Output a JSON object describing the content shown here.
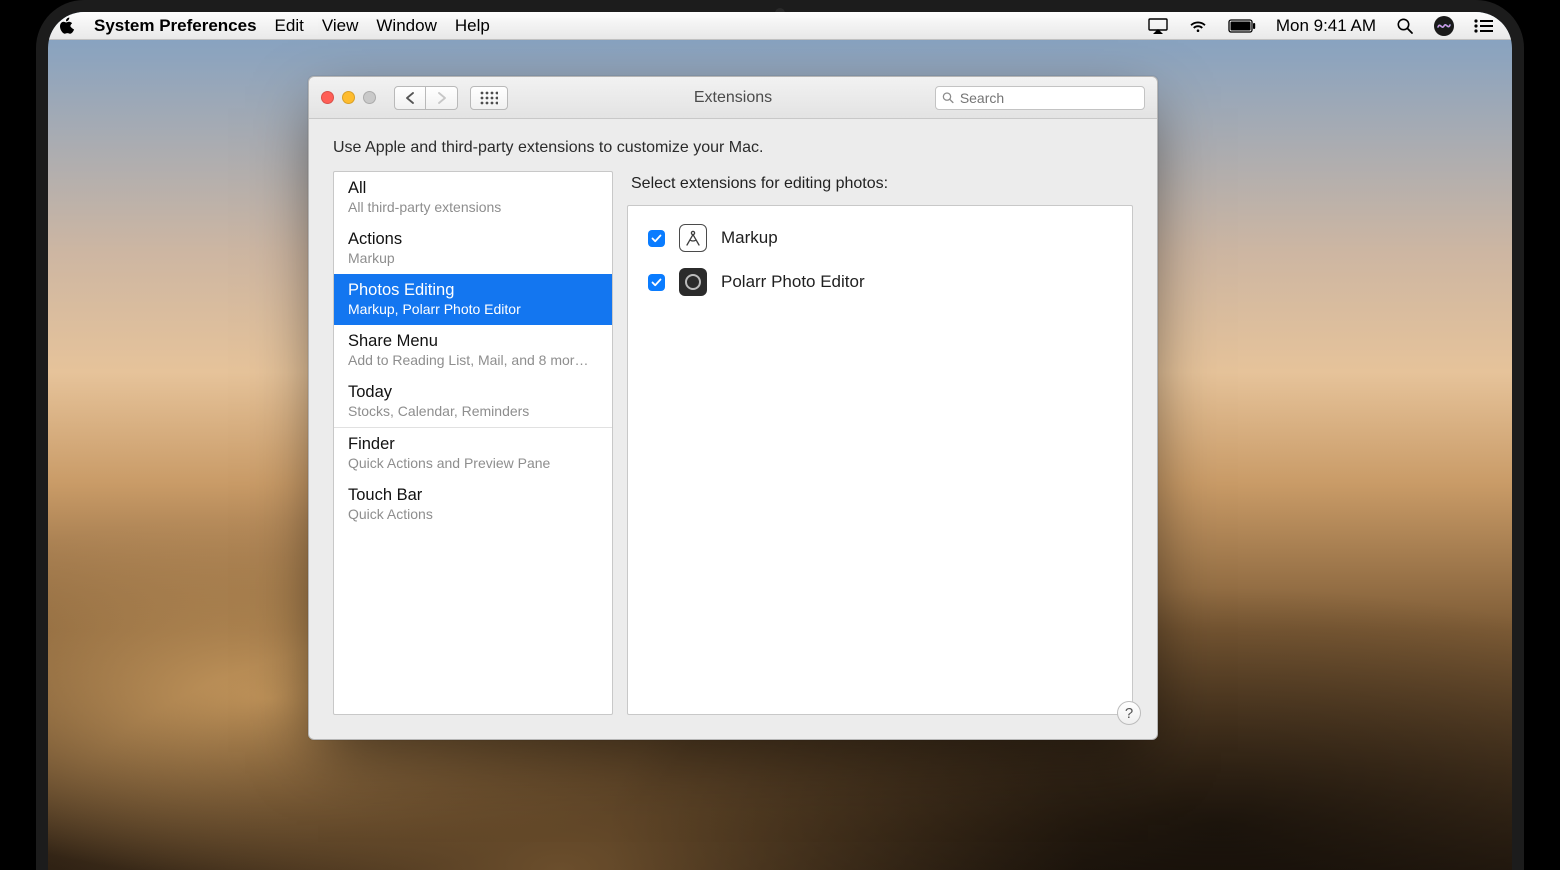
{
  "menubar": {
    "app_name": "System Preferences",
    "items": [
      "Edit",
      "View",
      "Window",
      "Help"
    ],
    "clock": "Mon 9:41 AM"
  },
  "window": {
    "title": "Extensions",
    "search_placeholder": "Search",
    "description": "Use Apple and third-party extensions to customize your Mac."
  },
  "sidebar": {
    "items": [
      {
        "title": "All",
        "subtitle": "All third-party extensions",
        "selected": false
      },
      {
        "title": "Actions",
        "subtitle": "Markup",
        "selected": false
      },
      {
        "title": "Photos Editing",
        "subtitle": "Markup, Polarr Photo Editor",
        "selected": true
      },
      {
        "title": "Share Menu",
        "subtitle": "Add to Reading List, Mail, and 8 mor…",
        "selected": false
      },
      {
        "title": "Today",
        "subtitle": "Stocks, Calendar, Reminders",
        "selected": false
      },
      {
        "title": "Finder",
        "subtitle": "Quick Actions and Preview Pane",
        "selected": false,
        "divider": true
      },
      {
        "title": "Touch Bar",
        "subtitle": "Quick Actions",
        "selected": false
      }
    ]
  },
  "detail": {
    "heading": "Select extensions for editing photos:",
    "extensions": [
      {
        "name": "Markup",
        "checked": true,
        "icon": "markup"
      },
      {
        "name": "Polarr Photo Editor",
        "checked": true,
        "icon": "polarr"
      }
    ]
  },
  "help_label": "?"
}
